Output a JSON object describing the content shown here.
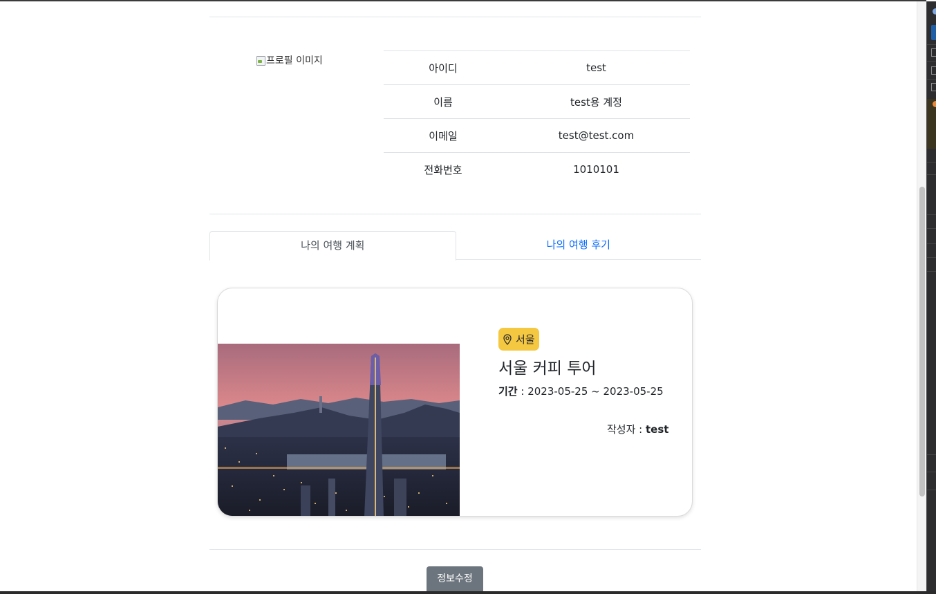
{
  "profile": {
    "image_alt": "프로필 이미지",
    "rows": [
      {
        "label": "아이디",
        "value": "test"
      },
      {
        "label": "이름",
        "value": "test용 계정"
      },
      {
        "label": "이메일",
        "value": "test@test.com"
      },
      {
        "label": "전화번호",
        "value": "1010101"
      }
    ]
  },
  "tabs": [
    {
      "label": "나의 여행 계획",
      "active": true
    },
    {
      "label": "나의 여행 후기",
      "active": false
    }
  ],
  "plan_card": {
    "location_badge": "서울",
    "location_icon": "map-pin-icon",
    "title": "서울 커피 투어",
    "period_label": "기간",
    "period_separator": " : ",
    "period_value": "2023-05-25 ~ 2023-05-25",
    "author_label": "작성자 : ",
    "author_value": "test",
    "badge_color": "#f5c842"
  },
  "actions": {
    "edit_label": "정보수정",
    "edit_color": "#6c757d"
  },
  "colors": {
    "link": "#0d6efd",
    "divider": "#dee2e6"
  }
}
